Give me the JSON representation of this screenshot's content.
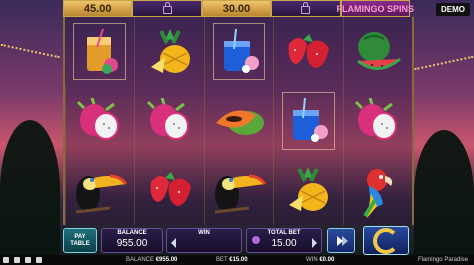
{
  "top_bar": {
    "cells": [
      "45.00",
      "",
      "30.00",
      "",
      "FLAMINGO SPINS"
    ],
    "demo_badge": "DEMO"
  },
  "reels": [
    [
      "cocktail-orange-icon",
      "pineapple-icon",
      "cocktail-blue-icon",
      "strawberry-icon",
      "watermelon-icon"
    ],
    [
      "dragonfruit-icon",
      "dragonfruit-icon",
      "papaya-icon",
      "cocktail-blue-icon",
      "dragonfruit-icon"
    ],
    [
      "toucan-icon",
      "strawberry-icon",
      "toucan-icon",
      "pineapple-icon",
      "parrot-icon"
    ]
  ],
  "controls": {
    "paytable_label_1": "PAY",
    "paytable_label_2": "TABLE",
    "balance_label": "BALANCE",
    "balance_value": "955.00",
    "win_label": "WIN",
    "win_value": "",
    "total_bet_label": "TOTAL BET",
    "total_bet_value": "15.00"
  },
  "status_bar": {
    "balance_label": "BALANCE",
    "balance_value": "€955.00",
    "bet_label": "BET",
    "bet_value": "€15.00",
    "win_label": "WIN",
    "win_value": "€0.00",
    "game_title": "Flamingo Paradise"
  },
  "colors": {
    "gold": "#f0c46a",
    "panel": "#2b1d4a",
    "accent_teal": "#7fd2e0",
    "spin_gold": "#f2c84a"
  }
}
